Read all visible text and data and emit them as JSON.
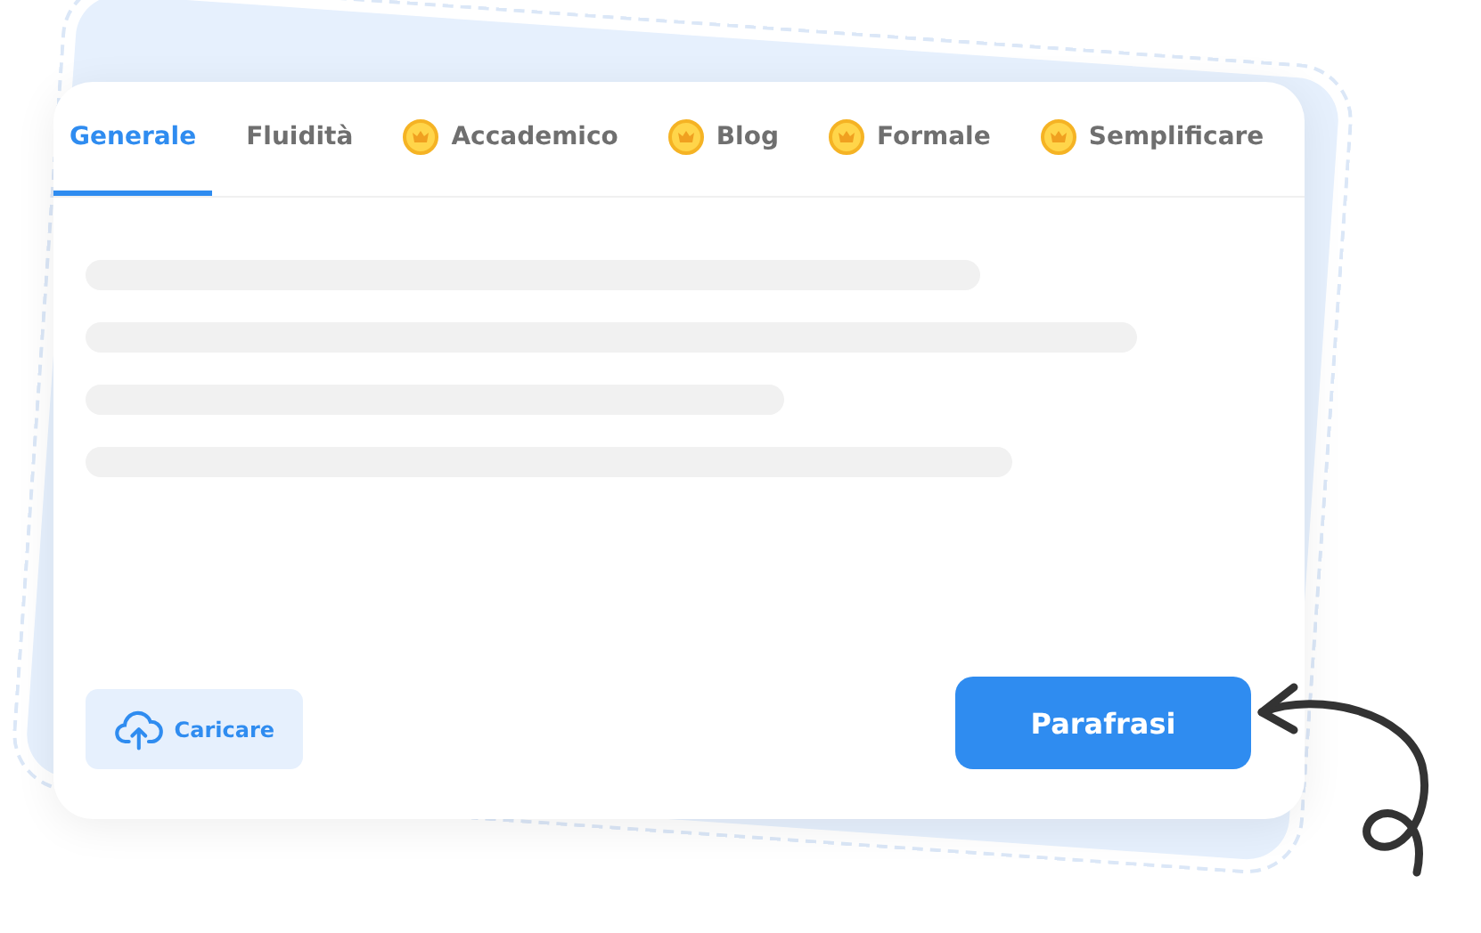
{
  "tabs": [
    {
      "label": "Generale",
      "selected": true,
      "premium": false
    },
    {
      "label": "Fluidità",
      "selected": false,
      "premium": false
    },
    {
      "label": "Accademico",
      "selected": false,
      "premium": true
    },
    {
      "label": "Blog",
      "selected": false,
      "premium": true
    },
    {
      "label": "Formale",
      "selected": false,
      "premium": true
    },
    {
      "label": "Semplificare",
      "selected": false,
      "premium": true
    }
  ],
  "upload_button": {
    "label": "Caricare"
  },
  "submit_button": {
    "label": "Parafrasi"
  }
}
